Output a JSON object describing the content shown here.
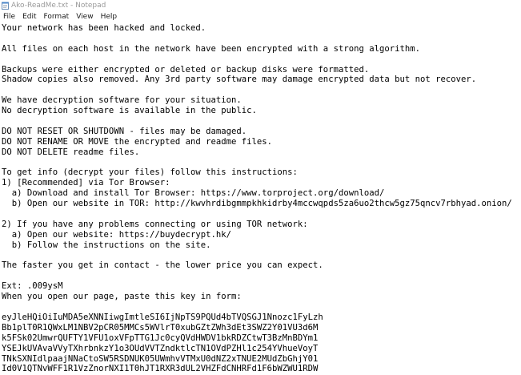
{
  "window": {
    "title": "Ako-ReadMe.txt - Notepad"
  },
  "menu": [
    "File",
    "Edit",
    "Format",
    "View",
    "Help"
  ],
  "document": {
    "lines": [
      "Your network has been hacked and locked.",
      "",
      "All files on each host in the network have been encrypted with a strong algorithm.",
      "",
      "Backups were either encrypted or deleted or backup disks were formatted.",
      "Shadow copies also removed. Any 3rd party software may damage encrypted data but not recover.",
      "",
      "We have decryption software for your situation.",
      "No decryption software is available in the public.",
      "",
      "DO NOT RESET OR SHUTDOWN - files may be damaged.",
      "DO NOT RENAME OR MOVE the encrypted and readme files.",
      "DO NOT DELETE readme files.",
      "",
      "To get info (decrypt your files) follow this instructions:",
      "1) [Recommended] via Tor Browser:",
      "  a) Download and install Tor Browser: https://www.torproject.org/download/",
      "  b) Open our website in TOR: http://kwvhrdibgmmpkhkidrby4mccwqpds5za6uo2thcw5gz75qncv7rbhyad.onion/",
      "",
      "2) If you have any problems connecting or using TOR network:",
      "  a) Open our website: https://buydecrypt.hk/",
      "  b) Follow the instructions on the site.",
      "",
      "The faster you get in contact - the lower price you can expect.",
      "",
      "Ext: .009ysM",
      "When you open our page, paste this key in form:",
      "",
      "eyJleHQiOiIuMDA5eXNNIiwgImtleSI6IjNpTS9PQUd4bTVQSGJ1Nnozc1FyLzh",
      "Bb1plT0R1QWxLM1NBV2pCR05MMCs5WVlrT0xubGZtZWh3dEt3SWZ2Y01VU3d6M",
      "k5FSk02UmwrQUFTY1VFU1oxVFpTTG1Jc0cyQVdHWDV1bkRDZCtwT3BzMnBDYm1",
      "YSEJkUVAvaVVyTXhrbnkzY1o3OUdVVTZndktlcTN1OVdPZHl1c254YVhueVoyT",
      "TNkSXNIdlpaajNNaCtoSW5RSDNUK05UWmhvVTMxU0dNZ2xTNUE2MUdZbGhjY01",
      "Id0V1QTNvWFF1R1VzZnorNXI1T0hJT1RXR3dUL2VHZFdCNHRFd1F6bWZWU1RDW"
    ]
  }
}
